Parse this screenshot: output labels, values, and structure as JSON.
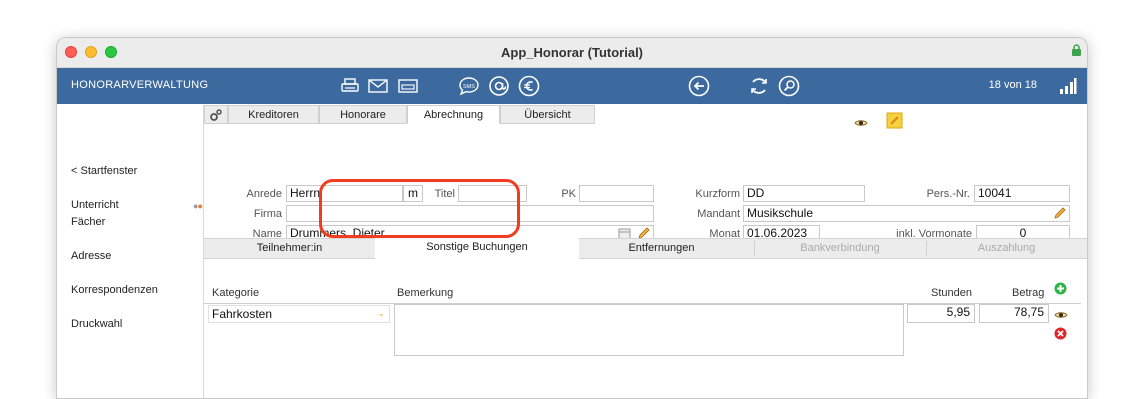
{
  "window": {
    "title": "App_Honorar (Tutorial)"
  },
  "toolbar": {
    "brand": "HONORARVERWALTUNG",
    "counter": "18 von 18",
    "sms_label": "SMS"
  },
  "sidebar": {
    "items": [
      "< Startfenster",
      "Unterricht",
      "Fächer",
      "Adresse",
      "Korrespondenzen",
      "Druckwahl"
    ]
  },
  "tabs": [
    "Kreditoren",
    "Honorare",
    "Abrechnung",
    "Übersicht"
  ],
  "form": {
    "anrede_label": "Anrede",
    "anrede_value": "Herrn",
    "anrede_suffix": "m",
    "titel_label": "Titel",
    "titel_value": "",
    "pk_label": "PK",
    "pk_value": "",
    "firma_label": "Firma",
    "firma_value": "",
    "name_label": "Name",
    "name_value": "Drummers, Dieter",
    "kurzform_label": "Kurzform",
    "kurzform_value": "DD",
    "persnr_label": "Pers.-Nr.",
    "persnr_value": "10041",
    "mandant_label": "Mandant",
    "mandant_value": "Musikschule",
    "monat_label": "Monat",
    "monat_value": "01.06.2023",
    "vormonate_label": "inkl. Vormonate",
    "vormonate_value": "0"
  },
  "subtabs": [
    "Teilnehmer:in",
    "Sonstige Buchungen",
    "Entfernungen",
    "Bankverbindung",
    "Auszahlung"
  ],
  "table": {
    "headers": {
      "kategorie": "Kategorie",
      "bemerkung": "Bemerkung",
      "stunden": "Stunden",
      "betrag": "Betrag"
    },
    "row": {
      "kategorie": "Fahrkosten",
      "bemerkung": "",
      "stunden": "5,95",
      "betrag": "78,75"
    }
  },
  "colors": {
    "toolbar": "#3d6a9e",
    "highlight": "#f33b1f",
    "add": "#2fb24a",
    "delete": "#e3242b"
  }
}
